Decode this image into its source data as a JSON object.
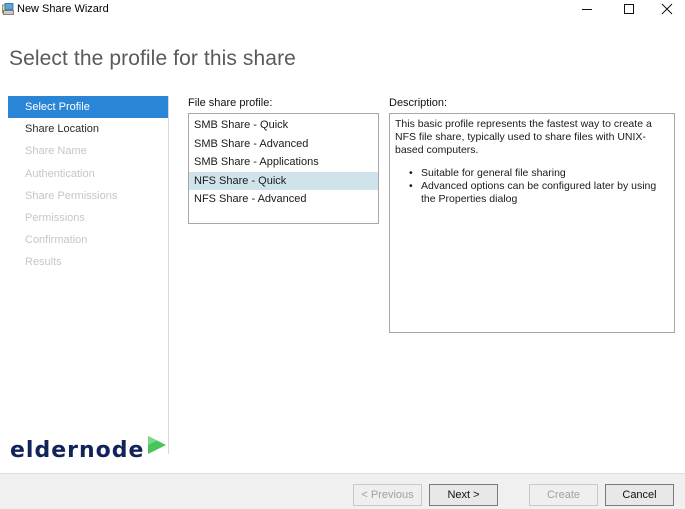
{
  "window": {
    "title": "New Share Wizard",
    "icon": "share-wizard-icon"
  },
  "page": {
    "title": "Select the profile for this share"
  },
  "nav": {
    "items": [
      {
        "label": "Select Profile",
        "state": "active"
      },
      {
        "label": "Share Location",
        "state": "enabled"
      },
      {
        "label": "Share Name",
        "state": "disabled"
      },
      {
        "label": "Authentication",
        "state": "disabled"
      },
      {
        "label": "Share Permissions",
        "state": "disabled"
      },
      {
        "label": "Permissions",
        "state": "disabled"
      },
      {
        "label": "Confirmation",
        "state": "disabled"
      },
      {
        "label": "Results",
        "state": "disabled"
      }
    ]
  },
  "profiles": {
    "label": "File share profile:",
    "selected": "NFS Share - Quick",
    "items": [
      "SMB Share - Quick",
      "SMB Share - Advanced",
      "SMB Share - Applications",
      "NFS Share - Quick",
      "NFS Share - Advanced"
    ]
  },
  "description": {
    "label": "Description:",
    "text": "This basic profile represents the fastest way to create a NFS file share, typically used to share files with UNIX-based computers.",
    "bullets": [
      "Suitable for general file sharing",
      "Advanced options can be configured later by using the Properties dialog"
    ]
  },
  "watermark": {
    "text": "eldernode"
  },
  "buttons": {
    "previous": "< Previous",
    "next": "Next >",
    "create": "Create",
    "cancel": "Cancel"
  },
  "colors": {
    "accent": "#2a85d6",
    "selection": "#cfe3ea",
    "logo_dark": "#11245a",
    "logo_green": "#47c45a"
  }
}
